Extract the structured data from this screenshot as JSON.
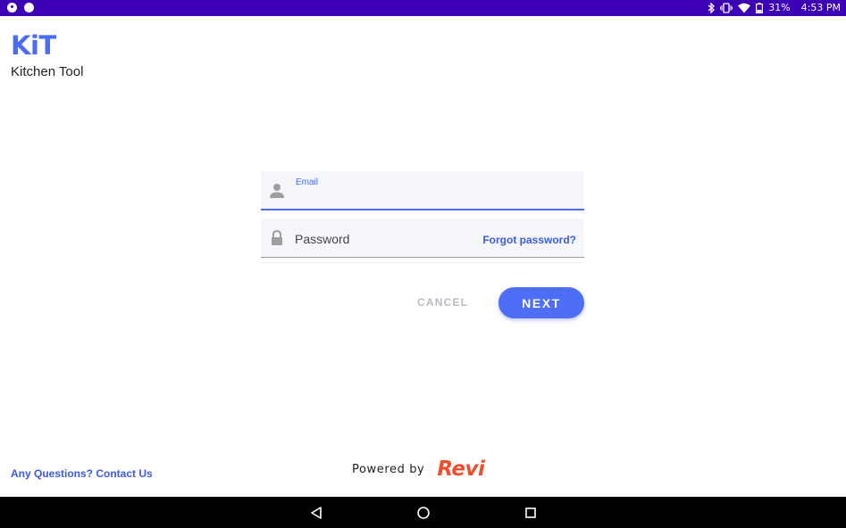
{
  "status_bar": {
    "left_icons": [
      "location-pin-icon",
      "notification-dot-icon"
    ],
    "right_icons": [
      "bluetooth-icon",
      "vibrate-icon",
      "wifi-icon",
      "battery-icon"
    ],
    "battery": "31%",
    "time": "4:53 PM",
    "background": "#3b00b3"
  },
  "app": {
    "logo": "KiT",
    "subtitle": "Kitchen Tool",
    "accent_color": "#4a6cf7"
  },
  "login_form": {
    "email_label": "Email",
    "email_value": "",
    "password_placeholder": "Password",
    "forgot_password": "Forgot password?",
    "cancel_label": "CANCEL",
    "next_label": "NEXT"
  },
  "footer": {
    "contact_link": "Any Questions? Contact Us",
    "powered_by": "Powered by",
    "brand": "Revi",
    "brand_color": "#f04e2d"
  },
  "nav_bar": {
    "buttons": [
      "back-icon",
      "home-icon",
      "recents-icon"
    ]
  }
}
